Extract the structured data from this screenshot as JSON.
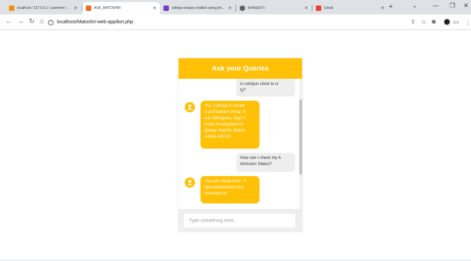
{
  "browser": {
    "tabs": [
      {
        "title": "localhost / 127.0.0.1 / userform / ...",
        "icon": "phpmyadmin-icon",
        "active": false,
        "color": "#f29111"
      },
      {
        "title": "ASK_MATOSHRI",
        "icon": "site-icon",
        "active": true,
        "color": "#e8711a"
      },
      {
        "title": "college enquiry chatbot using phi...",
        "icon": "bookmark-icon",
        "active": false,
        "color": "#6f42c1"
      },
      {
        "title": "8o45q927v",
        "icon": "globe-icon",
        "active": false,
        "color": "#5f6368"
      },
      {
        "title": "Gmail",
        "icon": "gmail-icon",
        "active": false,
        "color": "#ea4335"
      }
    ],
    "url": "localhost/Matoshri-web-app/bot.php"
  },
  "chat": {
    "header": "Ask your Queries",
    "messages": [
      {
        "from": "user",
        "text": "is campus close to ci\nty?"
      },
      {
        "from": "bot",
        "text": "Yes, College is situate\nd at Eklahare shivar, N\near Odhagaon, Opp H\nashik-Aurangabad Hi\nghway, Nashik, Mahar\nashtra 422105"
      },
      {
        "from": "user",
        "text": "How can I check my A\ndmission Status?"
      },
      {
        "from": "bot",
        "text": "You can check here : h\nttps://admissions.mat\noshri.edu.in/"
      }
    ],
    "input_placeholder": "Type something here.."
  },
  "colors": {
    "accent": "#ffc107",
    "user_bubble": "#eeeeee"
  }
}
